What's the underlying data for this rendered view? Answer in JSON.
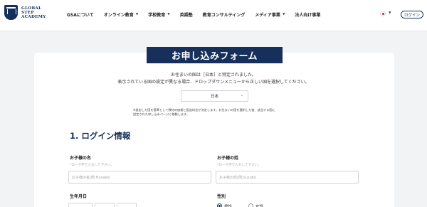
{
  "brand": {
    "line1": "GLOBAL",
    "line2": "STEP",
    "line3": "ACADEMY"
  },
  "nav": [
    {
      "label": "GSAについて",
      "dropdown": false
    },
    {
      "label": "オンライン教育",
      "dropdown": true
    },
    {
      "label": "学校教育",
      "dropdown": true
    },
    {
      "label": "英語塾",
      "dropdown": false
    },
    {
      "label": "教育コンサルティング",
      "dropdown": false
    },
    {
      "label": "メディア事業",
      "dropdown": true
    },
    {
      "label": "法人向け事業",
      "dropdown": false
    }
  ],
  "header": {
    "login_label": "ログイン",
    "flag_icon": "japan-flag-icon"
  },
  "form": {
    "title": "お申し込みフォーム",
    "notice_line1": "お住まいの国は［日本］と特定されました。",
    "notice_line2": "表示されている国の設定が異なる場合、ドロップダウンメニューから正しい国を選択してください。",
    "country_value": "日本",
    "small_note_line1": "※設定した国を基準として教材の価格と配送料金が決定します。お住まいの国を選択した後、該当する国に",
    "small_note_line2": "設定された申し込みページに移動します。",
    "section_title": "1. ログイン情報",
    "first_name": {
      "label": "お子様の名",
      "hint": "*ローマ字で入力して下さい。",
      "placeholder": "お子様の名(例:Hanako)"
    },
    "last_name": {
      "label": "お子様の姓",
      "hint": "*ローマ字で入力して下さい。",
      "placeholder": "お子様の姓(例:Suzuki)"
    },
    "birthdate_label": "生年月日",
    "gender": {
      "label": "性別",
      "options": [
        "男性",
        "女性"
      ],
      "selected": "男性"
    }
  },
  "colors": {
    "navy": "#16305b",
    "background": "#f2f3f5"
  }
}
